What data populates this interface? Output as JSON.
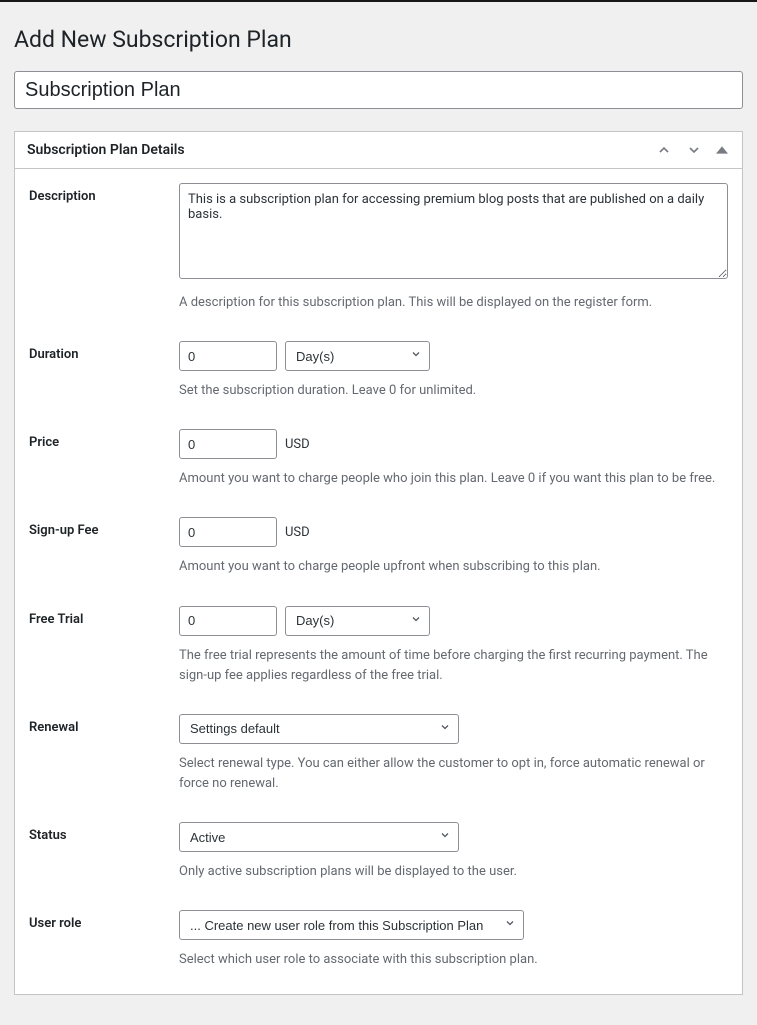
{
  "page": {
    "heading": "Add New Subscription Plan",
    "title_value": "Subscription Plan"
  },
  "metabox": {
    "title": "Subscription Plan Details"
  },
  "description": {
    "label": "Description",
    "value": "This is a subscription plan for accessing premium blog posts that are published on a daily basis.",
    "help": "A description for this subscription plan. This will be displayed on the register form."
  },
  "duration": {
    "label": "Duration",
    "value": "0",
    "unit": "Day(s)",
    "help": "Set the subscription duration. Leave 0 for unlimited."
  },
  "price": {
    "label": "Price",
    "value": "0",
    "currency": "USD",
    "help": "Amount you want to charge people who join this plan. Leave 0 if you want this plan to be free."
  },
  "signup_fee": {
    "label": "Sign-up Fee",
    "value": "0",
    "currency": "USD",
    "help": "Amount you want to charge people upfront when subscribing to this plan."
  },
  "free_trial": {
    "label": "Free Trial",
    "value": "0",
    "unit": "Day(s)",
    "help": "The free trial represents the amount of time before charging the first recurring payment. The sign-up fee applies regardless of the free trial."
  },
  "renewal": {
    "label": "Renewal",
    "value": "Settings default",
    "help": "Select renewal type. You can either allow the customer to opt in, force automatic renewal or force no renewal."
  },
  "status": {
    "label": "Status",
    "value": "Active",
    "help": "Only active subscription plans will be displayed to the user."
  },
  "user_role": {
    "label": "User role",
    "value": "... Create new user role from this Subscription Plan",
    "help": "Select which user role to associate with this subscription plan."
  }
}
